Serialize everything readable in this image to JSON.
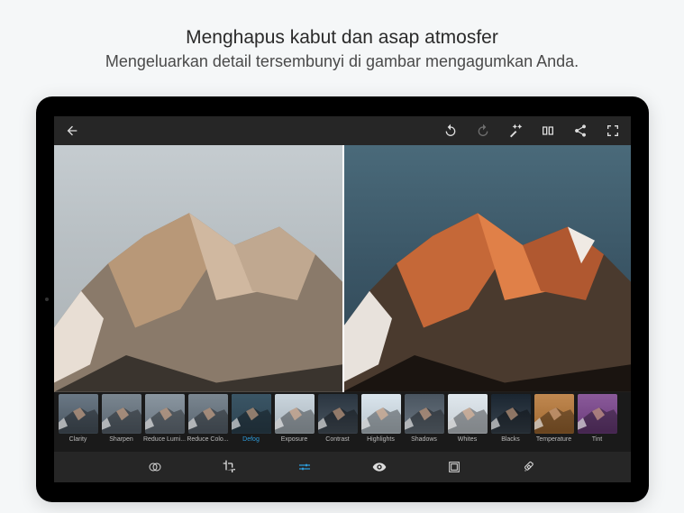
{
  "promo": {
    "headline": "Menghapus kabut dan asap atmosfer",
    "subheadline": "Mengeluarkan detail tersembunyi di gambar mengagumkan Anda."
  },
  "topbar": {
    "back": "←",
    "undo": "↶",
    "redo": "↷",
    "wand": "✦",
    "compare": "⧉",
    "share": "<",
    "fullscreen": "⛶"
  },
  "adjustments": [
    {
      "id": "clarity",
      "label": "Clarity",
      "tint": "linear-gradient(180deg,#6a7885 0%,#4a5560 100%)"
    },
    {
      "id": "sharpen",
      "label": "Sharpen",
      "tint": "linear-gradient(180deg,#7a8690 0%,#5a6570 100%)"
    },
    {
      "id": "reduce-lumi",
      "label": "Reduce Lumi...",
      "tint": "linear-gradient(180deg,#8a96a0 0%,#6a7580 100%)"
    },
    {
      "id": "reduce-colo",
      "label": "Reduce Colo...",
      "tint": "linear-gradient(180deg,#7a8690 0%,#5a6570 100%)"
    },
    {
      "id": "defog",
      "label": "Defog",
      "tint": "linear-gradient(180deg,#3a5565 0%,#2e4452 100%)",
      "selected": true
    },
    {
      "id": "exposure",
      "label": "Exposure",
      "tint": "linear-gradient(180deg,#cad5dd 0%,#aab5bd 100%)"
    },
    {
      "id": "contrast",
      "label": "Contrast",
      "tint": "linear-gradient(180deg,#2a3540 0%,#4a5560 100%)"
    },
    {
      "id": "highlights",
      "label": "Highlights",
      "tint": "linear-gradient(180deg,#dae5ed 0%,#bac5cd 100%)"
    },
    {
      "id": "shadows",
      "label": "Shadows",
      "tint": "linear-gradient(180deg,#4a5560 0%,#6a7580 100%)"
    },
    {
      "id": "whites",
      "label": "Whites",
      "tint": "linear-gradient(180deg,#e0e8ee 0%,#c5ccd2 100%)"
    },
    {
      "id": "blacks",
      "label": "Blacks",
      "tint": "linear-gradient(180deg,#1a2530 0%,#3a4550 100%)"
    },
    {
      "id": "temperature",
      "label": "Temperature",
      "tint": "linear-gradient(180deg,#c08850 0%,#a06830 100%)"
    },
    {
      "id": "tint",
      "label": "Tint",
      "tint": "linear-gradient(180deg,#8a5a9a 0%,#6a3a7a 100%)"
    }
  ],
  "bottomTools": [
    {
      "id": "looks",
      "icon": "overlap-circles"
    },
    {
      "id": "crop",
      "icon": "crop"
    },
    {
      "id": "adjust",
      "icon": "sliders",
      "active": true
    },
    {
      "id": "eye",
      "icon": "eye"
    },
    {
      "id": "border",
      "icon": "frame"
    },
    {
      "id": "heal",
      "icon": "bandage"
    }
  ]
}
